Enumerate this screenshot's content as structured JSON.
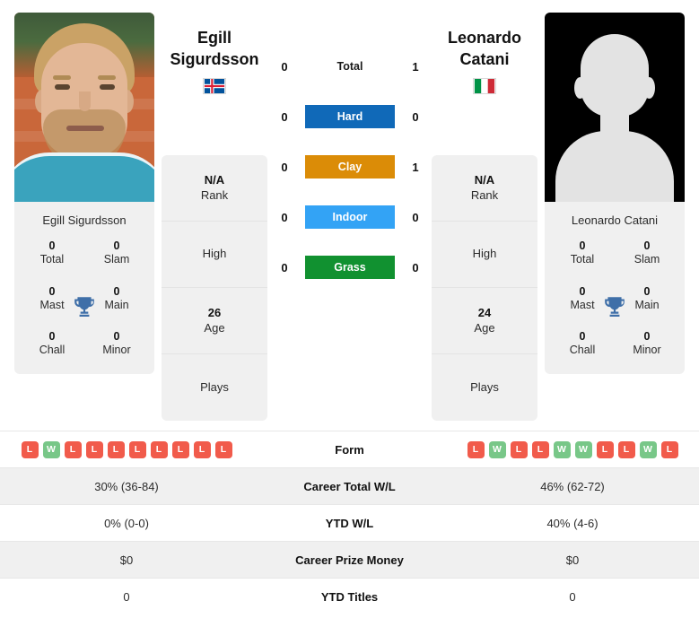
{
  "colors": {
    "hard": "#1069b8",
    "clay": "#db8c07",
    "indoor": "#33a3f5",
    "grass": "#119130",
    "win_badge": "#78c788",
    "loss_badge": "#f15b4b",
    "card_bg": "#f0f0f0",
    "trophy": "#3f6fa8"
  },
  "players": {
    "left": {
      "first_name": "Egill",
      "last_name": "Sigurdsson",
      "full_name": "Egill Sigurdsson",
      "country": "Iceland",
      "flag_icon": "iceland-flag-icon",
      "photo_alt": "Egill Sigurdsson photo",
      "titles": [
        {
          "num": "0",
          "label": "Total"
        },
        {
          "num": "0",
          "label": "Slam"
        },
        {
          "num": "0",
          "label": "Mast"
        },
        {
          "num": "0",
          "label": "Main"
        },
        {
          "num": "0",
          "label": "Chall"
        },
        {
          "num": "0",
          "label": "Minor"
        }
      ],
      "info": [
        {
          "value": "N/A",
          "label": "Rank"
        },
        {
          "value": "",
          "label": "High"
        },
        {
          "value": "26",
          "label": "Age"
        },
        {
          "value": "",
          "label": "Plays"
        }
      ],
      "form": [
        "L",
        "W",
        "L",
        "L",
        "L",
        "L",
        "L",
        "L",
        "L",
        "L"
      ],
      "career_total_wl": "30% (36-84)",
      "ytd_wl": "0% (0-0)",
      "career_prize_money": "$0",
      "ytd_titles": "0"
    },
    "right": {
      "first_name": "Leonardo",
      "last_name": "Catani",
      "full_name": "Leonardo Catani",
      "country": "Italy",
      "flag_icon": "italy-flag-icon",
      "photo_alt": "Leonardo Catani placeholder avatar",
      "titles": [
        {
          "num": "0",
          "label": "Total"
        },
        {
          "num": "0",
          "label": "Slam"
        },
        {
          "num": "0",
          "label": "Mast"
        },
        {
          "num": "0",
          "label": "Main"
        },
        {
          "num": "0",
          "label": "Chall"
        },
        {
          "num": "0",
          "label": "Minor"
        }
      ],
      "info": [
        {
          "value": "N/A",
          "label": "Rank"
        },
        {
          "value": "",
          "label": "High"
        },
        {
          "value": "24",
          "label": "Age"
        },
        {
          "value": "",
          "label": "Plays"
        }
      ],
      "form": [
        "L",
        "W",
        "L",
        "L",
        "W",
        "W",
        "L",
        "L",
        "W",
        "L"
      ],
      "career_total_wl": "46% (62-72)",
      "ytd_wl": "40% (4-6)",
      "career_prize_money": "$0",
      "ytd_titles": "0"
    }
  },
  "head_to_head": [
    {
      "surface": "Total",
      "left": "0",
      "right": "1",
      "style": "plain"
    },
    {
      "surface": "Hard",
      "left": "0",
      "right": "0",
      "style": "hard"
    },
    {
      "surface": "Clay",
      "left": "0",
      "right": "1",
      "style": "clay"
    },
    {
      "surface": "Indoor",
      "left": "0",
      "right": "0",
      "style": "indoor"
    },
    {
      "surface": "Grass",
      "left": "0",
      "right": "0",
      "style": "grass"
    }
  ],
  "stats_table": {
    "rows": [
      {
        "label": "Form",
        "type": "form",
        "shaded": false
      },
      {
        "label": "Career Total W/L",
        "type": "text",
        "shaded": true,
        "left": "30% (36-84)",
        "right": "46% (62-72)"
      },
      {
        "label": "YTD W/L",
        "type": "text",
        "shaded": false,
        "left": "0% (0-0)",
        "right": "40% (4-6)"
      },
      {
        "label": "Career Prize Money",
        "type": "text",
        "shaded": true,
        "left": "$0",
        "right": "$0"
      },
      {
        "label": "YTD Titles",
        "type": "text",
        "shaded": false,
        "left": "0",
        "right": "0"
      }
    ]
  }
}
